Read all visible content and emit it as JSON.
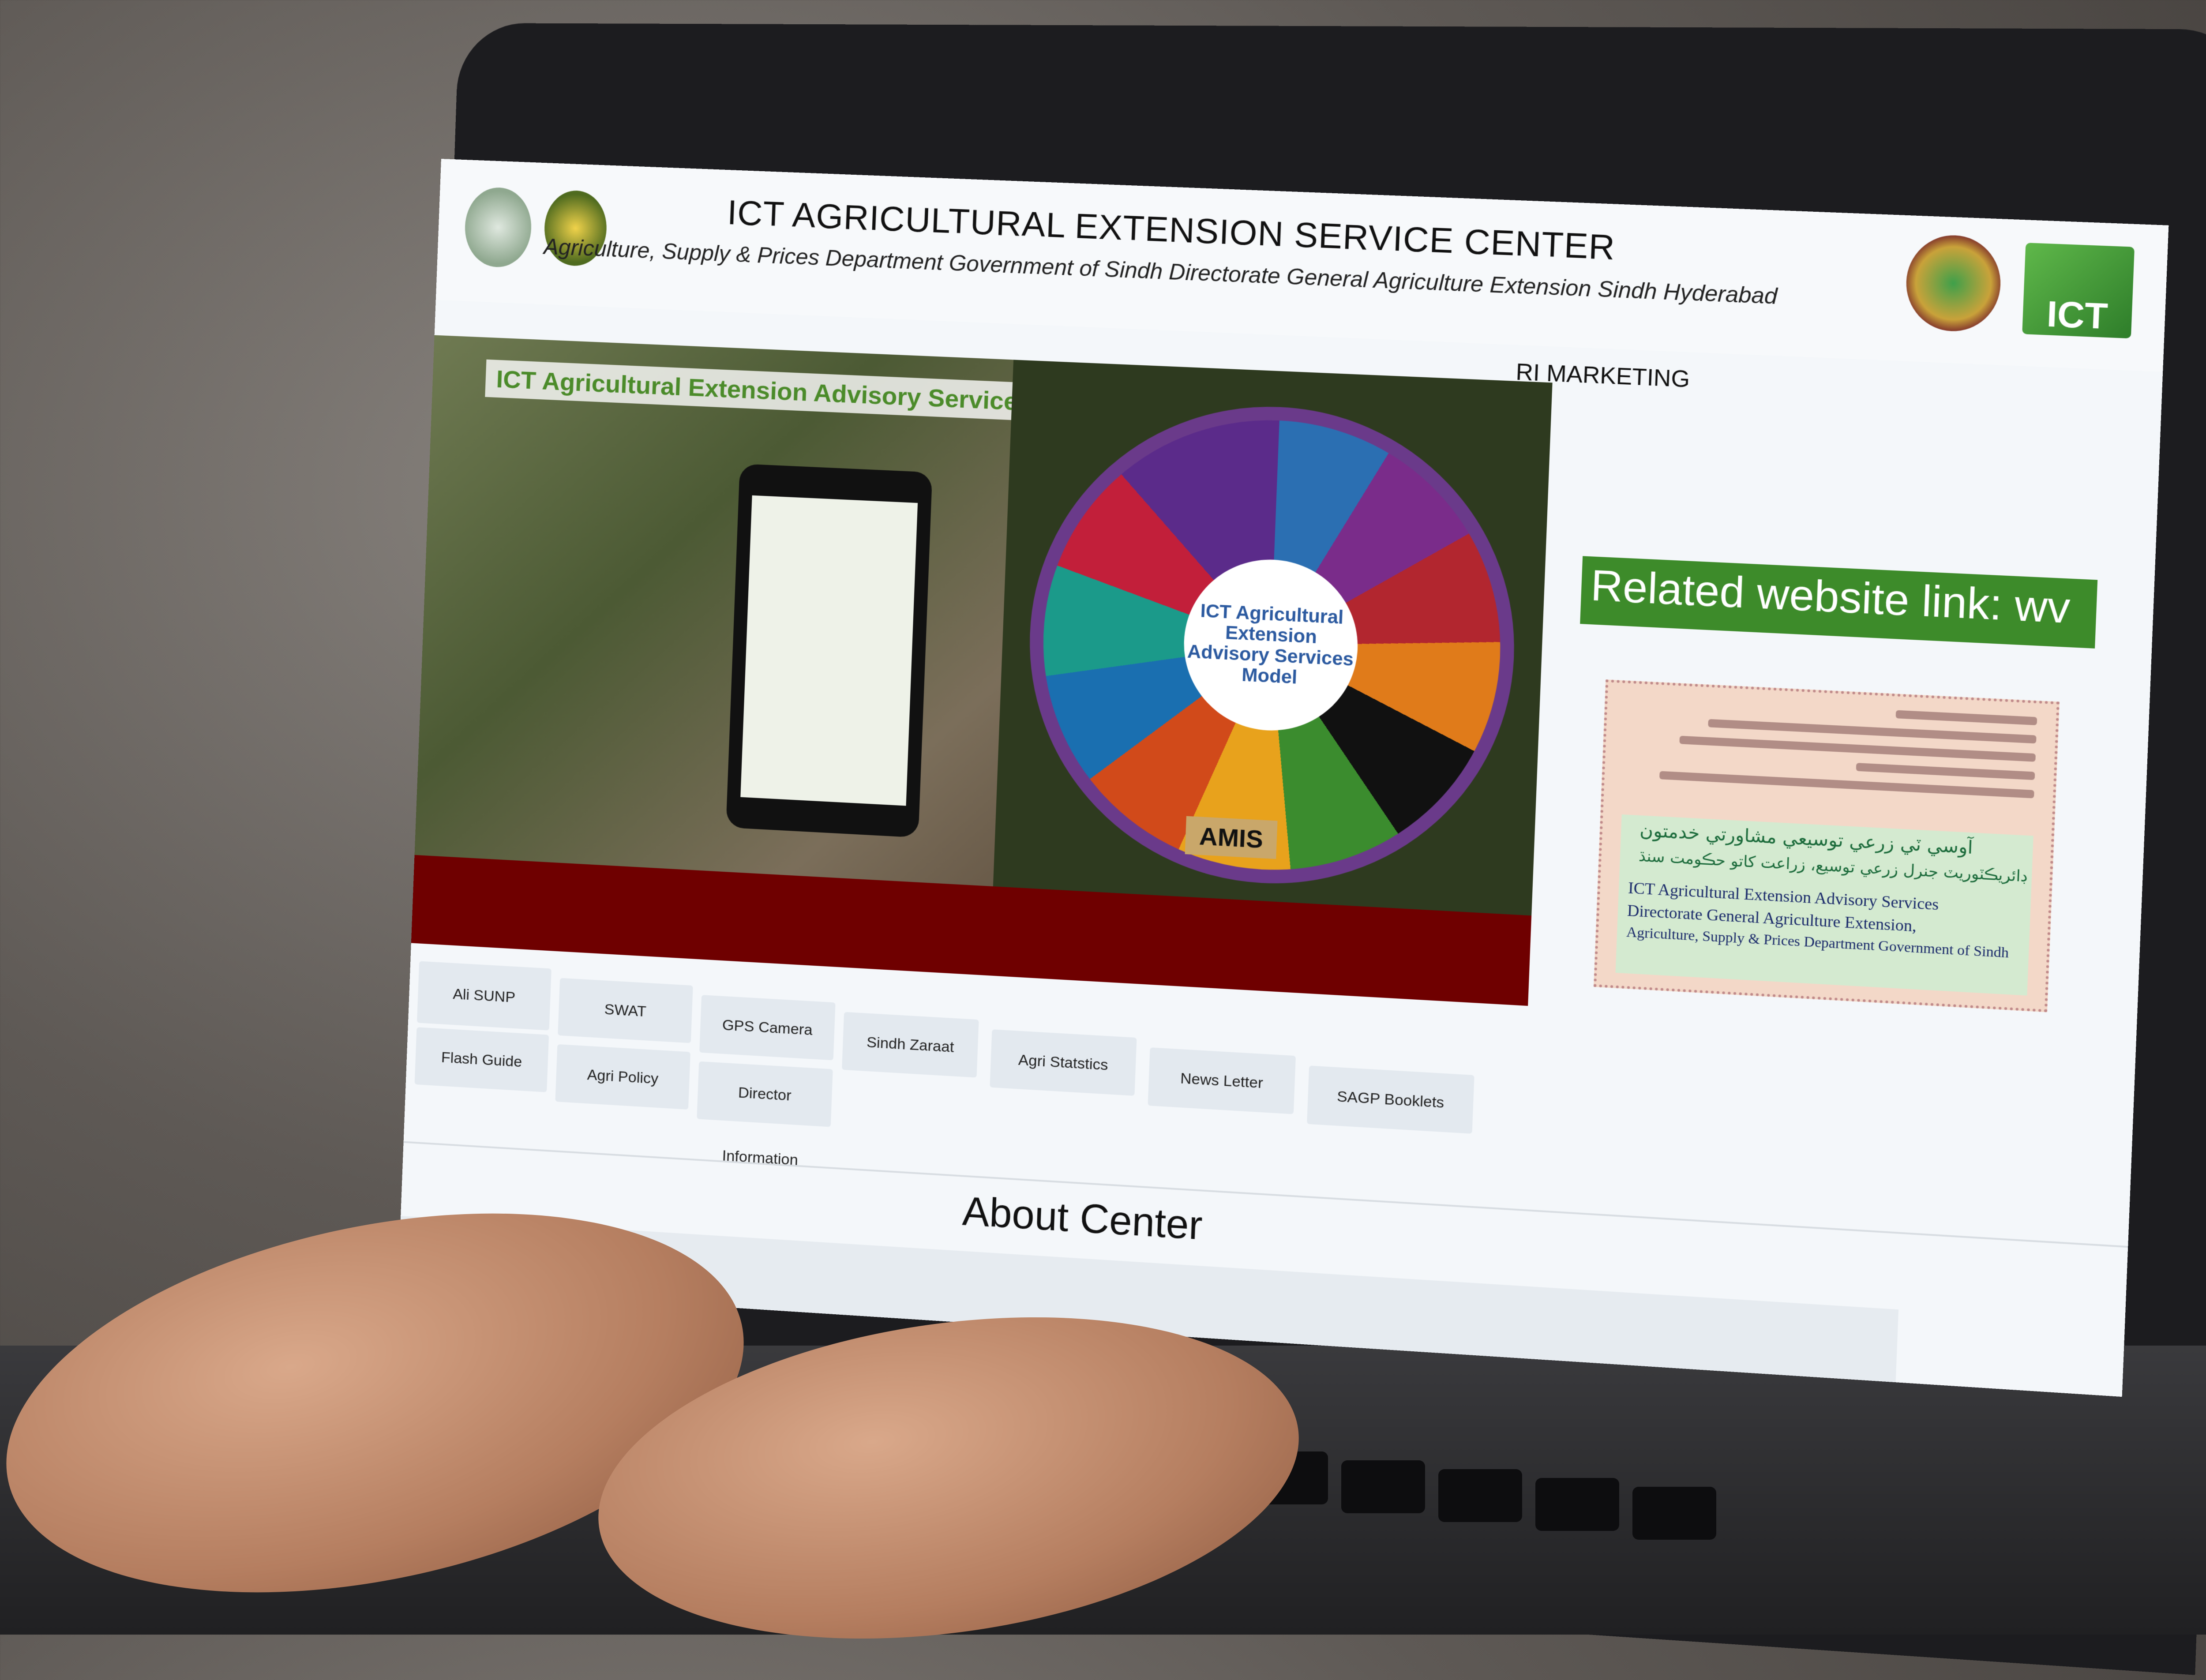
{
  "header": {
    "title": "ICT AGRICULTURAL EXTENSION SERVICE CENTER",
    "subtitle": "Agriculture, Supply & Prices Department Government of Sindh Directorate General Agriculture Extension Sindh Hyderabad",
    "logos": [
      "sindh-government-logo",
      "agriculture-department-logo",
      "pakistan-map-logo",
      "ict-extension-services-logo"
    ],
    "ict_logo_text": "ICT"
  },
  "marquee_top": "RI MARKETING",
  "hero": {
    "banner": "ICT Agricultural Extension Advisory Services Sindh",
    "wheel_center": "ICT Agricultural Extension Advisory Services Model",
    "amis_label": "AMIS"
  },
  "related_link": "Related website link: wv",
  "side_card": {
    "urdu_line_1": "آوسي ٽي زرعي توسيعي مشاورتي خدمتون",
    "urdu_line_2": "ڊائريڪٽوريٽ جنرل زرعي توسيع، زراعت کاتو حڪومت سنڌ",
    "line_1": "ICT Agricultural Extension Advisory Services",
    "line_2": "Directorate General Agriculture Extension,",
    "line_3": "Agriculture, Supply & Prices Department Government of Sindh"
  },
  "nav": {
    "items": [
      {
        "label": "Ali SUNP"
      },
      {
        "label": "SWAT"
      },
      {
        "label": "GPS Camera"
      },
      {
        "label": "Sindh Zaraat"
      },
      {
        "label": "Agri Statstics"
      },
      {
        "label": "News Letter"
      },
      {
        "label": "SAGP Booklets"
      },
      {
        "label": "Flash Guide"
      },
      {
        "label": "Agri Policy"
      },
      {
        "label": "Director"
      }
    ],
    "information": "Information"
  },
  "about_heading": "About Center",
  "colors": {
    "hero_bar": "#6f0000",
    "link_banner": "#3d8b2a",
    "banner_text": "#4b8b2a"
  }
}
